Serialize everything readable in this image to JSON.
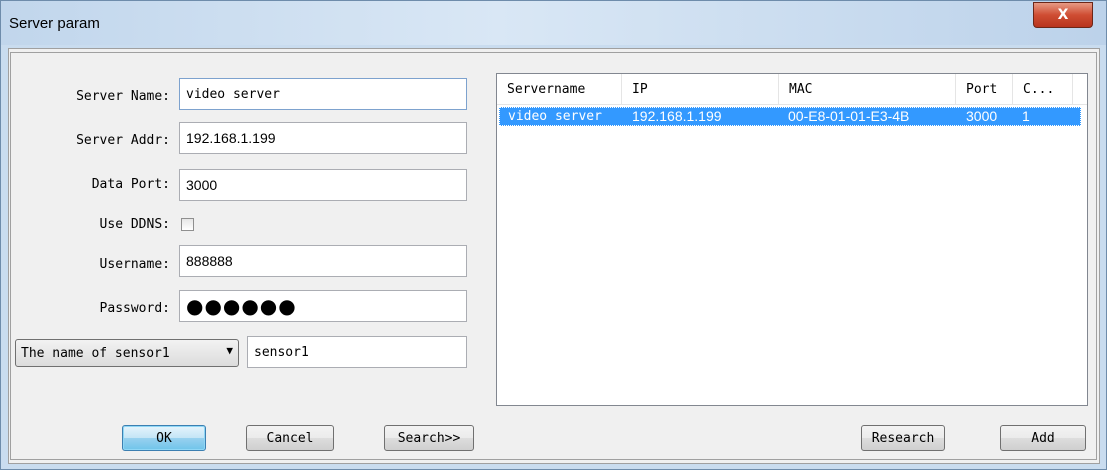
{
  "window": {
    "title": "Server param",
    "close_label": "X"
  },
  "form": {
    "server_name_label": "Server Name:",
    "server_name_value": "video server",
    "server_addr_label": "Server Addr:",
    "server_addr_value": "192.168.1.199",
    "data_port_label": "Data Port:",
    "data_port_value": "3000",
    "use_ddns_label": "Use DDNS:",
    "use_ddns_checked": false,
    "username_label": "Username:",
    "username_value": "888888",
    "password_label": "Password:",
    "password_value": "●●●●●●",
    "sensor_select_value": "The name of sensor1",
    "sensor_name_value": "sensor1"
  },
  "list": {
    "columns": [
      "Servername",
      "IP",
      "MAC",
      "Port",
      "C..."
    ],
    "rows": [
      [
        "video server",
        "192.168.1.199",
        "00-E8-01-01-E3-4B",
        "3000",
        "1"
      ]
    ]
  },
  "buttons": {
    "ok": "OK",
    "cancel": "Cancel",
    "search": "Search>>",
    "research": "Research",
    "add": "Add"
  }
}
